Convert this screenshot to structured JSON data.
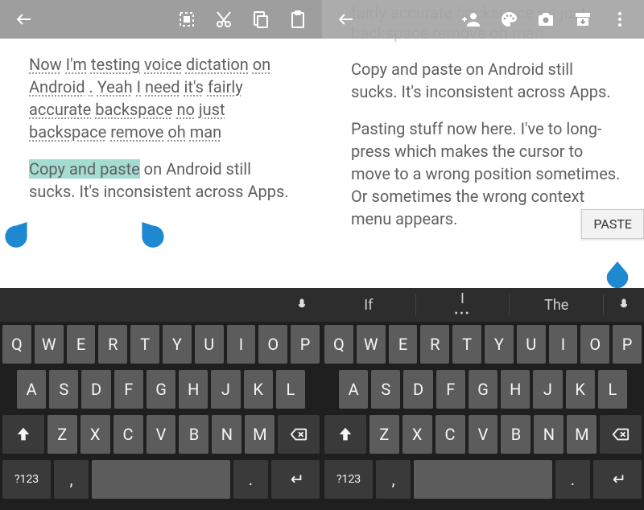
{
  "left": {
    "toolbar": {
      "icons": [
        "back",
        "select-all",
        "cut",
        "copy",
        "paste"
      ]
    },
    "para1_words": [
      "Now",
      "I'm",
      "testing",
      "voice",
      "dictation",
      "on",
      "Android",
      ".",
      "Yeah",
      "I",
      "need",
      "it's",
      "fairly",
      "accurate",
      "backspace",
      "no",
      "just",
      "backspace",
      "remove",
      "oh",
      "man"
    ],
    "para2_selected": "Copy and paste",
    "para2_rest": " on Android still sucks. It's inconsistent across Apps."
  },
  "right": {
    "toolbar": {
      "icons": [
        "back",
        "add-person",
        "palette",
        "camera",
        "archive",
        "overflow"
      ]
    },
    "ghost": "fairly accurate backspace no just backspace remove oh man",
    "para1": "Copy and paste on Android still sucks. It's inconsistent across Apps.",
    "para2": "Pasting stuff now here. I've to long-press which makes  the cursor to move to a wrong position sometimes. Or sometimes the wrong context menu appears.",
    "pastePopup": "PASTE"
  },
  "suggestions": {
    "left": [],
    "right": [
      "If",
      "I",
      "The"
    ]
  },
  "keyboard": {
    "row1": [
      "Q",
      "W",
      "E",
      "R",
      "T",
      "Y",
      "U",
      "I",
      "O",
      "P"
    ],
    "row2": [
      "A",
      "S",
      "D",
      "F",
      "G",
      "H",
      "J",
      "K",
      "L"
    ],
    "row3": [
      "Z",
      "X",
      "C",
      "V",
      "B",
      "N",
      "M"
    ],
    "row4": {
      "sym": "?123",
      "comma": ",",
      "period": "."
    }
  }
}
